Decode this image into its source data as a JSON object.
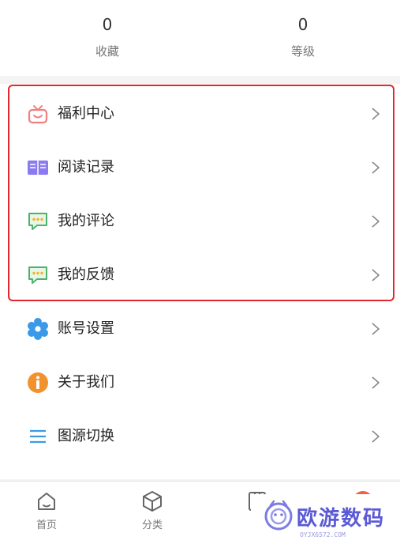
{
  "stats": [
    {
      "value": "0",
      "label": "收藏"
    },
    {
      "value": "0",
      "label": "等级"
    }
  ],
  "menu": {
    "items": [
      {
        "label": "福利中心",
        "icon": "gift-icon"
      },
      {
        "label": "阅读记录",
        "icon": "book-icon"
      },
      {
        "label": "我的评论",
        "icon": "comment-icon"
      },
      {
        "label": "我的反馈",
        "icon": "feedback-icon"
      },
      {
        "label": "账号设置",
        "icon": "gear-icon"
      },
      {
        "label": "关于我们",
        "icon": "info-icon"
      },
      {
        "label": "图源切换",
        "icon": "list-icon"
      }
    ]
  },
  "tabs": [
    {
      "label": "首页",
      "icon": "home-icon"
    },
    {
      "label": "分类",
      "icon": "cube-icon"
    },
    {
      "label": "",
      "icon": "bookshelf-icon"
    },
    {
      "label": "",
      "icon": "profile-icon"
    }
  ],
  "watermark": {
    "title": "欧游数码",
    "subtitle": "OYJX6572.COM"
  },
  "colors": {
    "highlight": "#e0282e",
    "accent": "#f0614d",
    "watermark": "#5a5ad6"
  }
}
